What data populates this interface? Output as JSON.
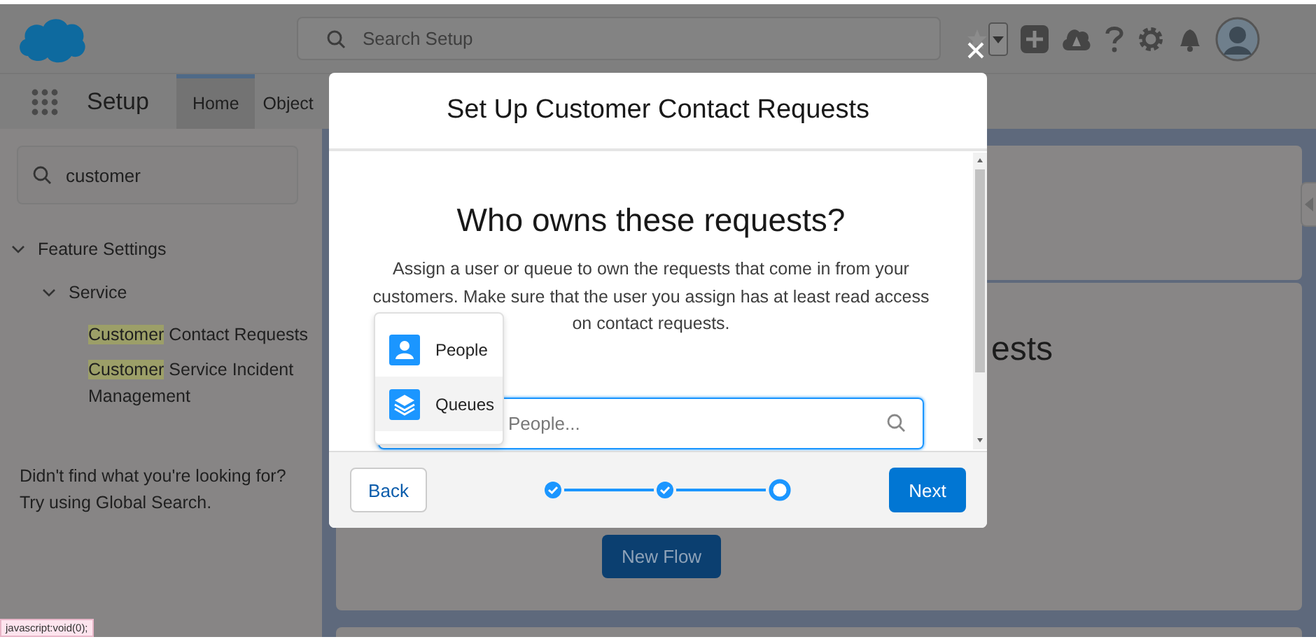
{
  "header": {
    "search": {
      "placeholder": "Search Setup"
    }
  },
  "nav": {
    "app_name": "Setup",
    "tabs": [
      {
        "label": "Home",
        "selected": true
      },
      {
        "label": "Object",
        "selected": false
      }
    ]
  },
  "sidebar": {
    "search": {
      "value": "customer"
    },
    "tree": [
      {
        "label": "Feature Settings",
        "expanded": true,
        "children": [
          {
            "label": "Service",
            "expanded": true,
            "children": [
              {
                "match": "Customer",
                "rest": " Contact Requests"
              },
              {
                "match": "Customer",
                "rest": " Service Incident Management"
              }
            ]
          }
        ]
      }
    ],
    "help_lines": [
      "Didn't find what you're looking for?",
      "Try using Global Search."
    ]
  },
  "main": {
    "heading_fragment": "ests",
    "button": "New Flow"
  },
  "modal": {
    "title": "Set Up Customer Contact Requests",
    "heading": "Who owns these requests?",
    "description": "Assign a user or queue to own the requests that come in from your customers. Make sure that the user you assign has at least read access on contact requests.",
    "lookup": {
      "placeholder": "People..."
    },
    "dropdown": [
      {
        "kind": "person",
        "label": "People",
        "selected": false
      },
      {
        "kind": "queue",
        "label": "Queues",
        "selected": true
      }
    ],
    "steps": [
      {
        "complete": true
      },
      {
        "complete": true
      },
      {
        "complete": false
      }
    ],
    "back": "Back",
    "next": "Next"
  },
  "status_tooltip": "javascript:void(0);"
}
